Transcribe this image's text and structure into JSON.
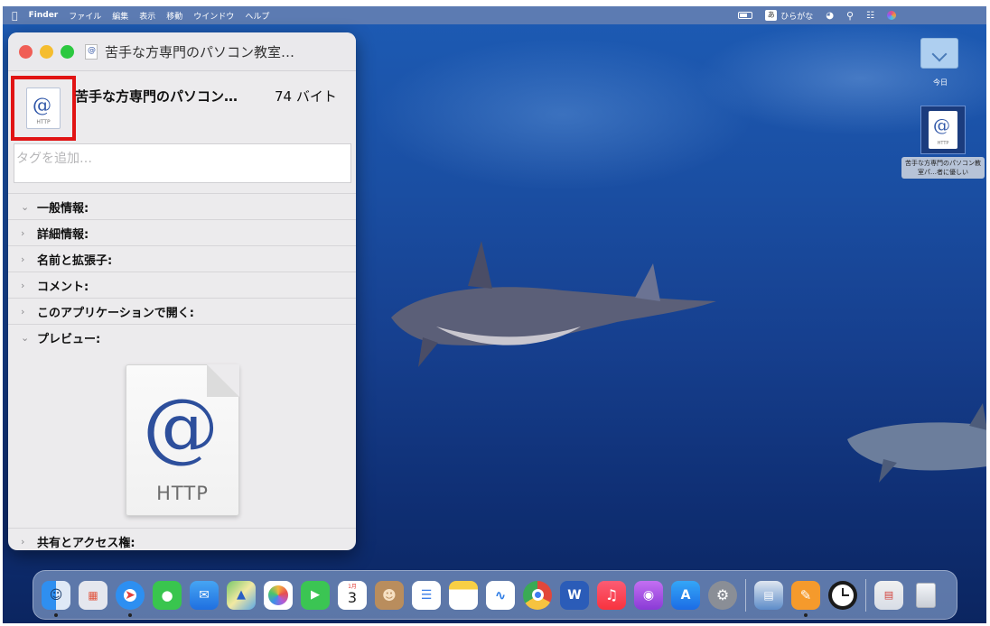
{
  "menubar": {
    "apple": "",
    "items": [
      "Finder",
      "ファイル",
      "編集",
      "表示",
      "移動",
      "ウインドウ",
      "ヘルプ"
    ],
    "ime_badge": "あ",
    "ime_label": "ひらがな"
  },
  "window": {
    "title": "苦手な方専門のパソコン教室…",
    "file_name": "苦手な方専門のパソコン…",
    "file_size": "74 バイト",
    "tag_placeholder": "タグを追加…",
    "sections": [
      {
        "label": "一般情報:",
        "expanded": true
      },
      {
        "label": "詳細情報:",
        "expanded": false
      },
      {
        "label": "名前と拡張子:",
        "expanded": false
      },
      {
        "label": "コメント:",
        "expanded": false
      },
      {
        "label": "このアプリケーションで開く:",
        "expanded": false
      },
      {
        "label": "プレビュー:",
        "expanded": true
      }
    ],
    "share_section": "共有とアクセス権:",
    "preview": {
      "symbol": "@",
      "type_label": "HTTP"
    },
    "icon": {
      "symbol": "@",
      "type_label": "HTTP"
    }
  },
  "desktop": {
    "today_folder": "今日",
    "file_label": "苦手な方専門のパソコン教室パ…者に優しい",
    "file_icon": {
      "symbol": "@",
      "type_label": "HTTP"
    }
  },
  "dock": {
    "apps": [
      "finder",
      "launchpad",
      "safari",
      "messages",
      "mail",
      "maps",
      "photos",
      "facetime",
      "calendar",
      "contacts",
      "reminders",
      "notes",
      "freeform",
      "chrome",
      "word",
      "music",
      "podcasts",
      "app-store",
      "system-preferences",
      "preview",
      "pages",
      "clock",
      "downloads",
      "trash"
    ],
    "calendar_month": "1月",
    "calendar_day": "3"
  }
}
